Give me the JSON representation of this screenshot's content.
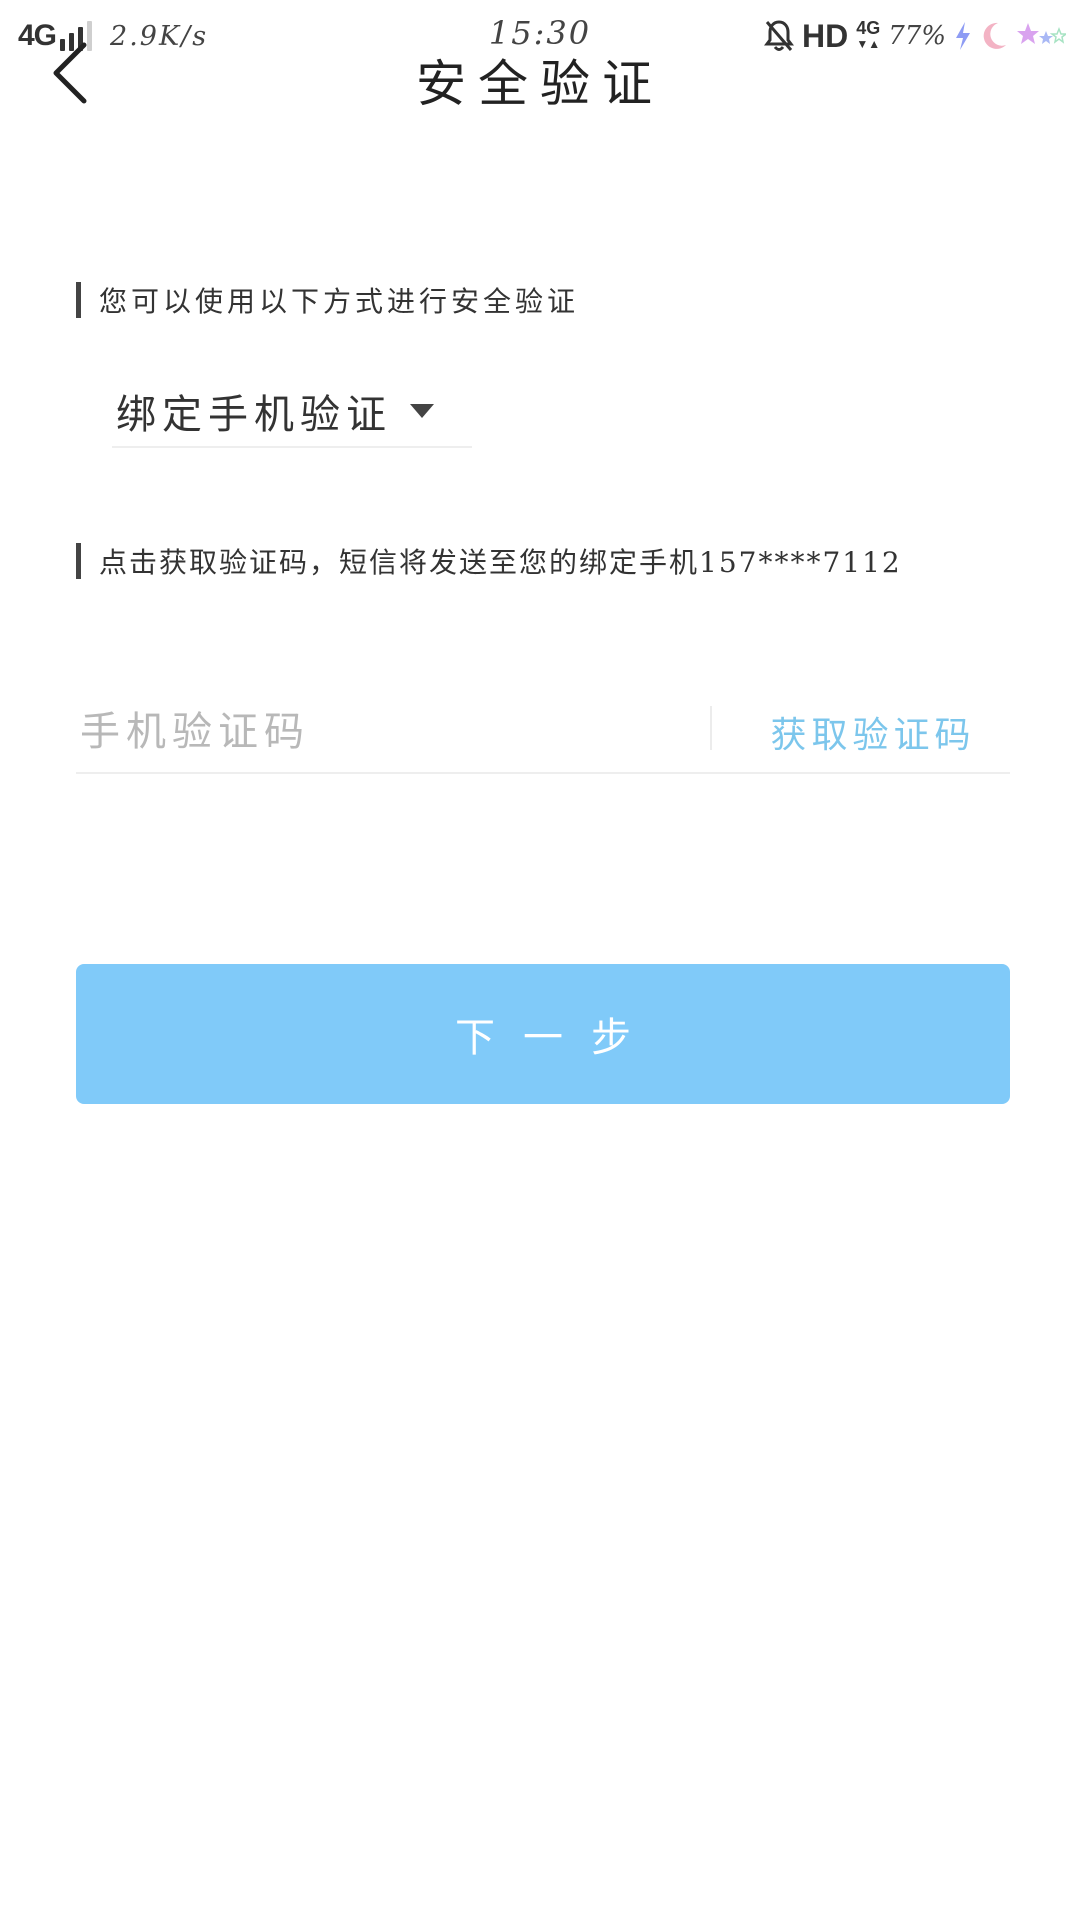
{
  "status_bar": {
    "network": "4G",
    "speed": "2.9K/s",
    "time": "15:30",
    "hd_label": "HD",
    "network_small": "4G",
    "battery": "77%",
    "icons": [
      "bell-off-icon",
      "charging-icon",
      "moon-icon",
      "star-icon"
    ]
  },
  "nav": {
    "title": "安全验证"
  },
  "verify": {
    "methods_label": "您可以使用以下方式进行安全验证",
    "method_selected": "绑定手机验证",
    "sms_hint": "点击获取验证码，短信将发送至您的绑定手机157****7112",
    "code_placeholder": "手机验证码",
    "code_value": "",
    "get_code_label": "获取验证码",
    "next_label": "下一步"
  },
  "colors": {
    "accent": "#80caf9",
    "link": "#7cc6ec",
    "placeholder": "#b8b8b8"
  }
}
